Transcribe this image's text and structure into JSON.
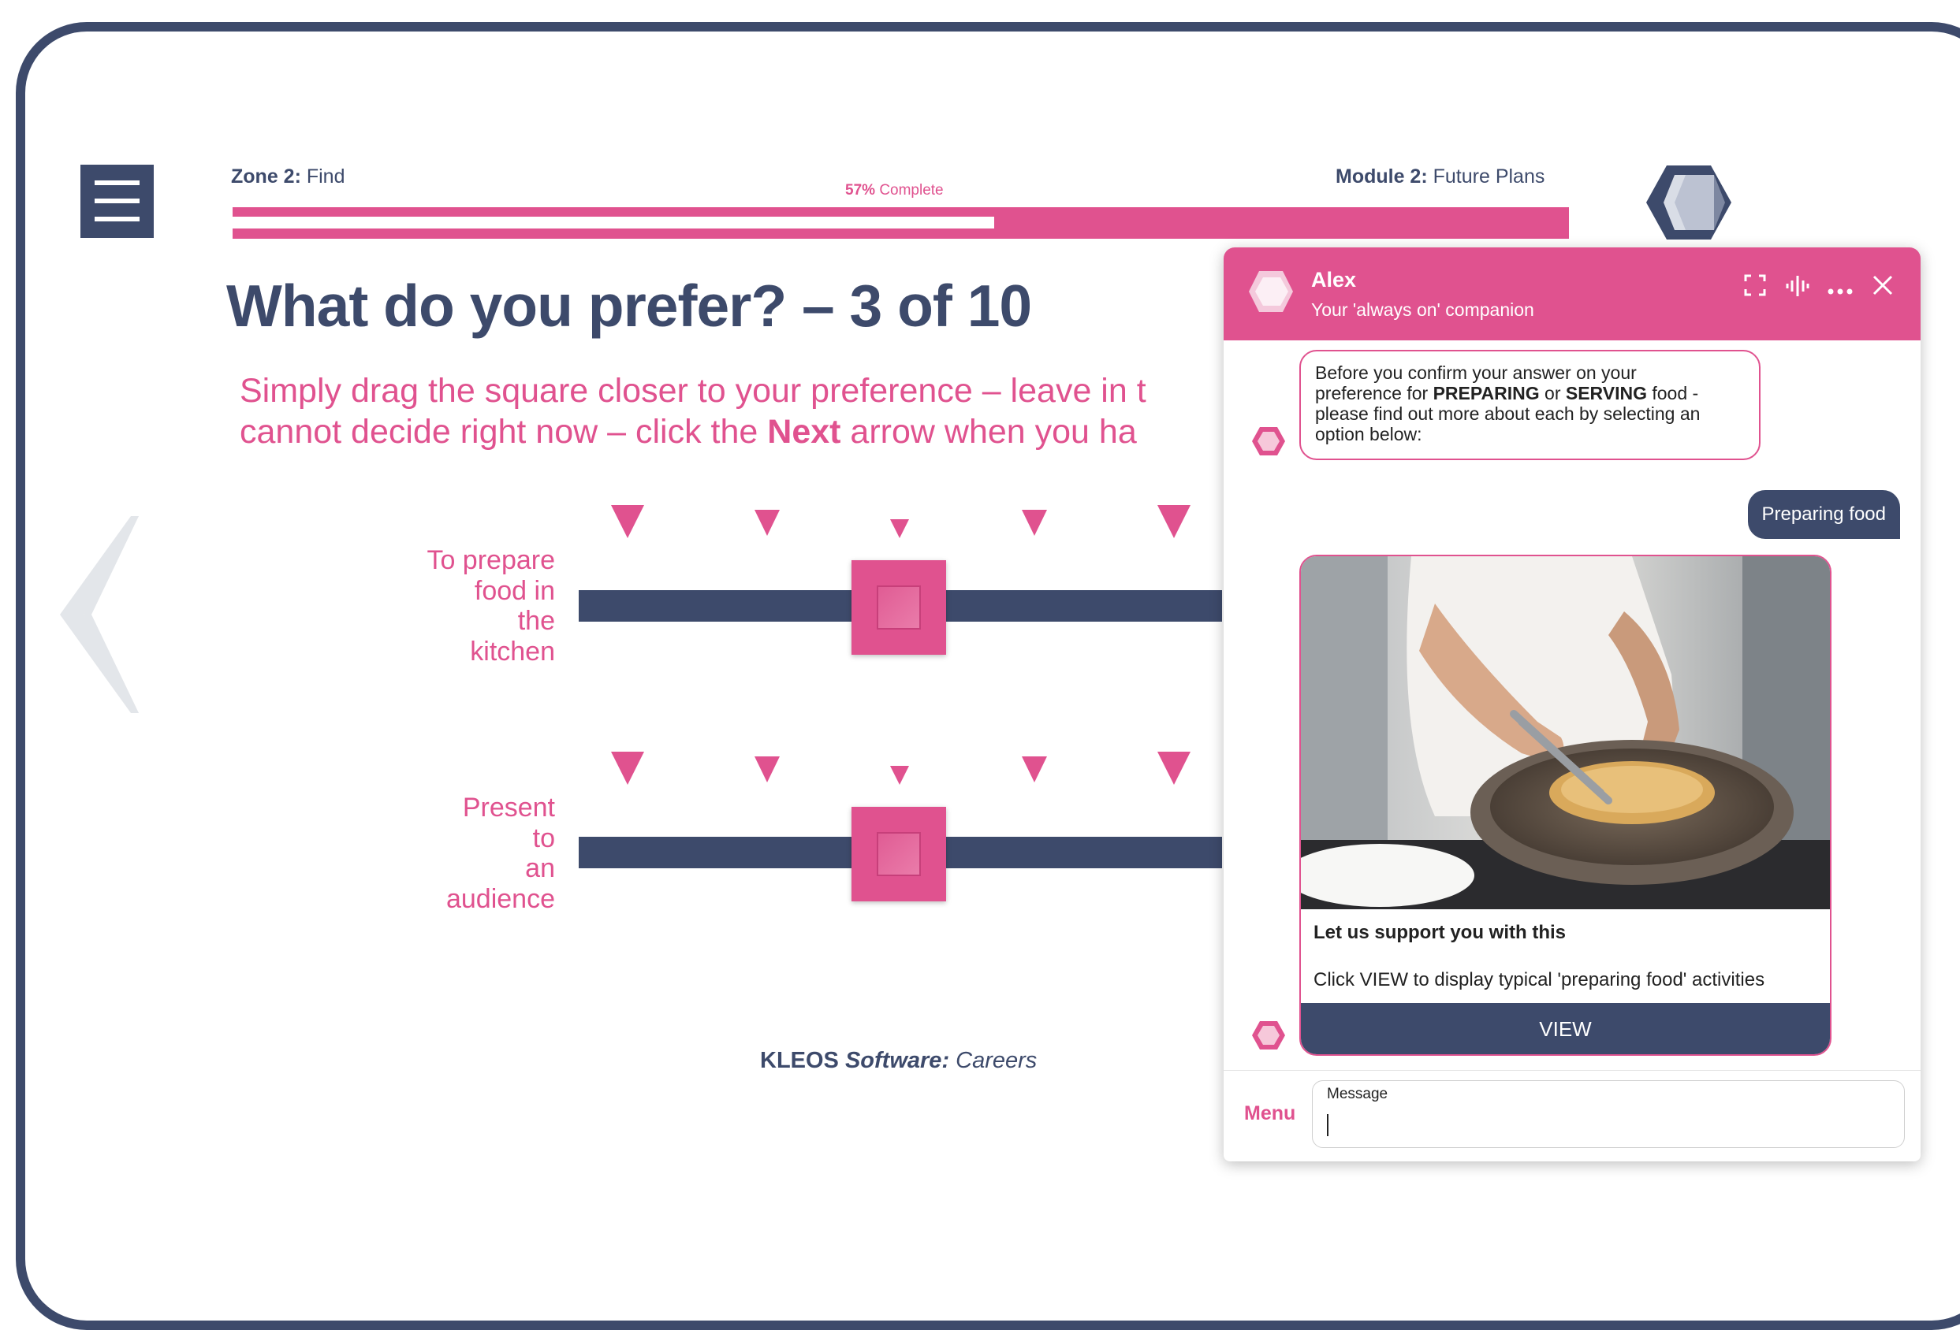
{
  "header": {
    "zone_label": "Zone 2:",
    "zone_value": "Find",
    "module_label": "Module 2:",
    "module_value": "Future Plans",
    "progress_percent_text": "57%",
    "progress_complete_text": "Complete",
    "progress_fraction": 0.57
  },
  "page": {
    "title": "What do you prefer? – 3 of 10",
    "instruction_line1": "Simply drag the  square closer to your preference – leave in t",
    "instruction_line2_a": "cannot decide right now – click the ",
    "instruction_line2_bold": "Next",
    "instruction_line2_b": " arrow when you ha"
  },
  "sliders": [
    {
      "label_lines": [
        "To prepare",
        "food in",
        "the",
        "kitchen"
      ],
      "position": "middle"
    },
    {
      "label_lines": [
        "Present",
        "to",
        "an",
        "audience"
      ],
      "position": "middle"
    }
  ],
  "footer": {
    "brand_bold": "KLEOS",
    "brand_italic": "Software:",
    "brand_rest": " Careers"
  },
  "chat": {
    "agent_name": "Alex",
    "agent_subtitle": "Your 'always on' companion",
    "bot_message_1": "Before you confirm your answer on your",
    "bot_message_2": "preference for ",
    "bot_message_bold_1": "PREPARING",
    "bot_message_3": " or ",
    "bot_message_bold_2": "SERVING",
    "bot_message_4": " food -",
    "bot_message_5": "please find out more about each by selecting an",
    "bot_message_6": "option below:",
    "user_message": "Preparing food",
    "card_title": "Let us support you with this",
    "card_text": "Click VIEW to display typical 'preparing food' activities",
    "card_button": "VIEW",
    "menu_label": "Menu",
    "message_label": "Message",
    "icons": [
      "expand-icon",
      "voice-icon",
      "more-icon",
      "close-icon"
    ]
  },
  "colors": {
    "navy": "#3d4a6b",
    "pink": "#e0528f"
  }
}
